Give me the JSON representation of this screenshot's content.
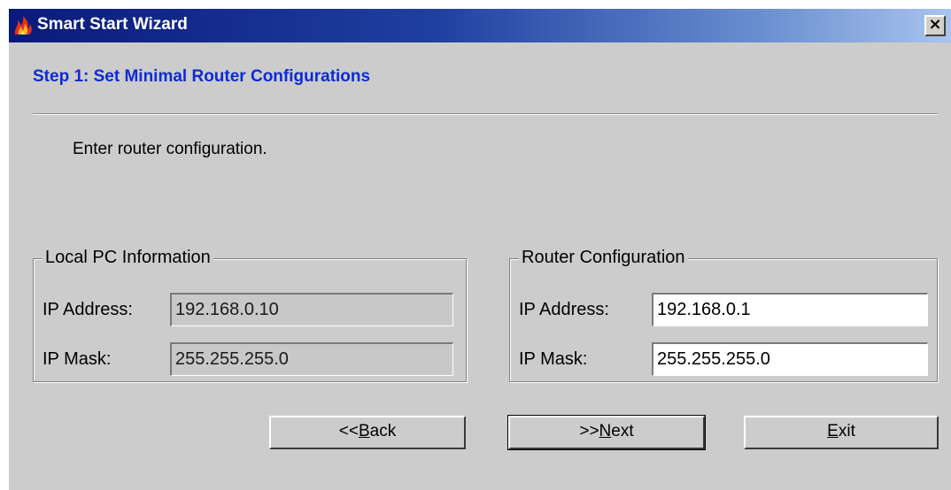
{
  "window": {
    "title": "Smart Start Wizard",
    "close_label": "×"
  },
  "step": {
    "heading": "Step 1: Set Minimal Router Configurations",
    "instruction": "Enter router configuration."
  },
  "local_pc": {
    "group_label": "Local PC Information",
    "ip_address_label": "IP Address:",
    "ip_address_value": "192.168.0.10",
    "ip_mask_label": "IP Mask:",
    "ip_mask_value": "255.255.255.0"
  },
  "router": {
    "group_label": "Router Configuration",
    "ip_address_label": "IP Address:",
    "ip_address_value": "192.168.0.1",
    "ip_mask_label": "IP Mask:",
    "ip_mask_value": "255.255.255.0"
  },
  "buttons": {
    "back": {
      "prefix": "<<",
      "mnemonic": "B",
      "rest": "ack"
    },
    "next": {
      "prefix": ">>",
      "mnemonic": "N",
      "rest": "ext"
    },
    "exit": {
      "prefix": "",
      "mnemonic": "E",
      "rest": "xit"
    }
  },
  "colors": {
    "heading": "#0d2bd6",
    "title_bar_start": "#0a1a7a",
    "title_bar_end": "#a9c4ee",
    "dialog_face": "#cccccc"
  },
  "icons": {
    "title": "flame-icon",
    "close": "close-icon"
  }
}
